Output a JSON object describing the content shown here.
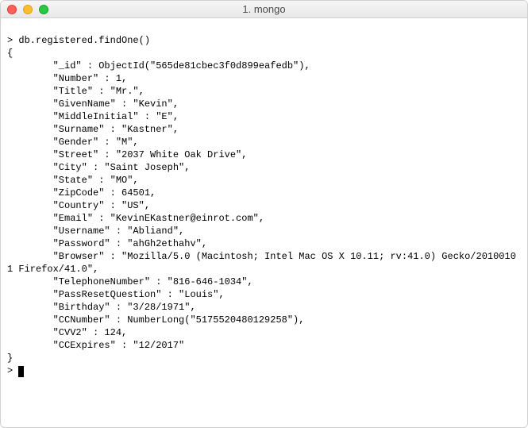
{
  "window": {
    "title": "1. mongo"
  },
  "terminal": {
    "prompt": ">",
    "command": "db.registered.findOne()",
    "open_brace": "{",
    "close_brace": "}",
    "final_prompt": "> ",
    "fields": [
      {
        "key": "\"_id\"",
        "sep": " : ",
        "value": "ObjectId(\"565de81cbec3f0d899eafedb\"),"
      },
      {
        "key": "\"Number\"",
        "sep": " : ",
        "value": "1,"
      },
      {
        "key": "\"Title\"",
        "sep": " : ",
        "value": "\"Mr.\","
      },
      {
        "key": "\"GivenName\"",
        "sep": " : ",
        "value": "\"Kevin\","
      },
      {
        "key": "\"MiddleInitial\"",
        "sep": " : ",
        "value": "\"E\","
      },
      {
        "key": "\"Surname\"",
        "sep": " : ",
        "value": "\"Kastner\","
      },
      {
        "key": "\"Gender\"",
        "sep": " : ",
        "value": "\"M\","
      },
      {
        "key": "\"Street\"",
        "sep": " : ",
        "value": "\"2037 White Oak Drive\","
      },
      {
        "key": "\"City\"",
        "sep": " : ",
        "value": "\"Saint Joseph\","
      },
      {
        "key": "\"State\"",
        "sep": " : ",
        "value": "\"MO\","
      },
      {
        "key": "\"ZipCode\"",
        "sep": " : ",
        "value": "64501,"
      },
      {
        "key": "\"Country\"",
        "sep": " : ",
        "value": "\"US\","
      },
      {
        "key": "\"Email\"",
        "sep": " : ",
        "value": "\"KevinEKastner@einrot.com\","
      },
      {
        "key": "\"Username\"",
        "sep": " : ",
        "value": "\"Abliand\","
      },
      {
        "key": "\"Password\"",
        "sep": " : ",
        "value": "\"ahGh2ethahv\","
      },
      {
        "key": "\"Browser\"",
        "sep": " : ",
        "value": "\"Mozilla/5.0 (Macintosh; Intel Mac OS X 10.11; rv:41.0) Gecko/20100101 Firefox/41.0\","
      },
      {
        "key": "\"TelephoneNumber\"",
        "sep": " : ",
        "value": "\"816-646-1034\","
      },
      {
        "key": "\"PassResetQuestion\"",
        "sep": " : ",
        "value": "\"Louis\","
      },
      {
        "key": "\"Birthday\"",
        "sep": " : ",
        "value": "\"3/28/1971\","
      },
      {
        "key": "\"CCNumber\"",
        "sep": " : ",
        "value": "NumberLong(\"5175520480129258\"),"
      },
      {
        "key": "\"CVV2\"",
        "sep": " : ",
        "value": "124,"
      },
      {
        "key": "\"CCExpires\"",
        "sep": " : ",
        "value": "\"12/2017\""
      }
    ]
  }
}
